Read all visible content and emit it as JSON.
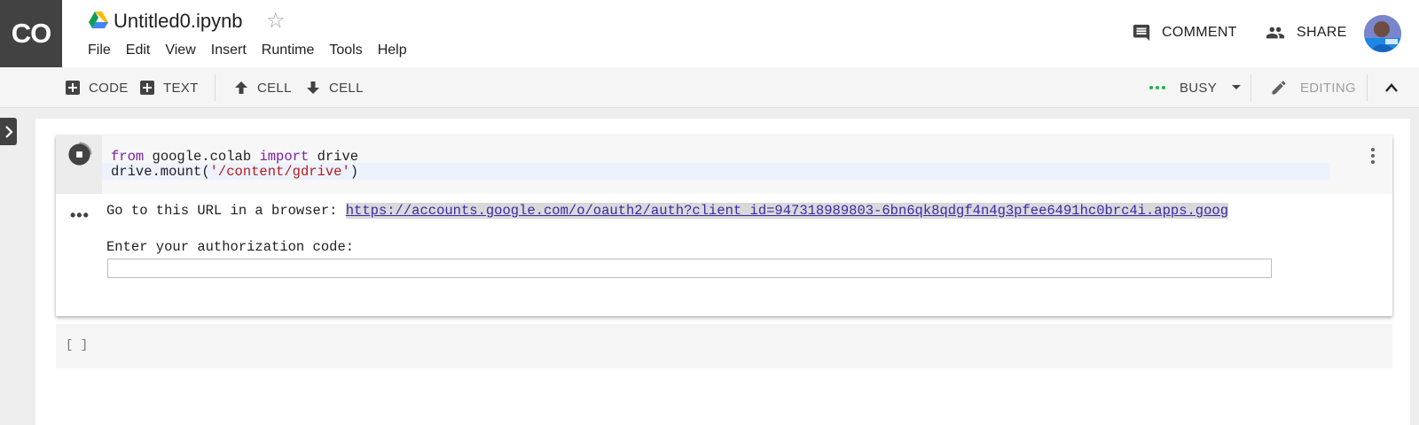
{
  "header": {
    "logo_text": "CO",
    "title": "Untitled0.ipynb",
    "menu": [
      "File",
      "Edit",
      "View",
      "Insert",
      "Runtime",
      "Tools",
      "Help"
    ],
    "comment_label": "COMMENT",
    "share_label": "SHARE"
  },
  "toolbar": {
    "add_code_label": "CODE",
    "add_text_label": "TEXT",
    "cell_up_label": "CELL",
    "cell_down_label": "CELL",
    "status_label": "BUSY",
    "mode_label": "EDITING"
  },
  "cell1": {
    "code": {
      "line1": {
        "kw1": "from",
        "mid": " google.colab ",
        "kw2": "import",
        "end": " drive"
      },
      "line2": {
        "pre": "drive.mount(",
        "str": "'/content/gdrive'",
        "post": ")"
      }
    },
    "output": {
      "url_prefix": "Go to this URL in a browser: ",
      "url": "https://accounts.google.com/o/oauth2/auth?client_id=947318989803-6bn6qk8qdgf4n4g3pfee6491hc0brc4i.apps.goog",
      "auth_prompt": "Enter your authorization code:",
      "auth_value": ""
    }
  },
  "cell2": {
    "brackets": "[ ]"
  },
  "colors": {
    "logo_bg": "#424242",
    "busy_green": "#22b14c",
    "keyword": "#7b1fa2",
    "string": "#b71c1c",
    "link": "#3c2aa8"
  },
  "icons": {
    "logo": "colab-logo",
    "drive": "google-drive-icon",
    "star": "star-outline-icon",
    "comment": "comment-icon",
    "share": "people-icon",
    "add": "plus-box-icon",
    "up": "arrow-up-icon",
    "down": "arrow-down-icon",
    "busy": "three-dots-icon",
    "dropdown": "caret-down-icon",
    "edit": "pencil-icon",
    "collapse": "chevron-up-icon",
    "side": "chevron-right-icon",
    "run": "stop-circle-icon",
    "more": "more-vert-icon"
  }
}
